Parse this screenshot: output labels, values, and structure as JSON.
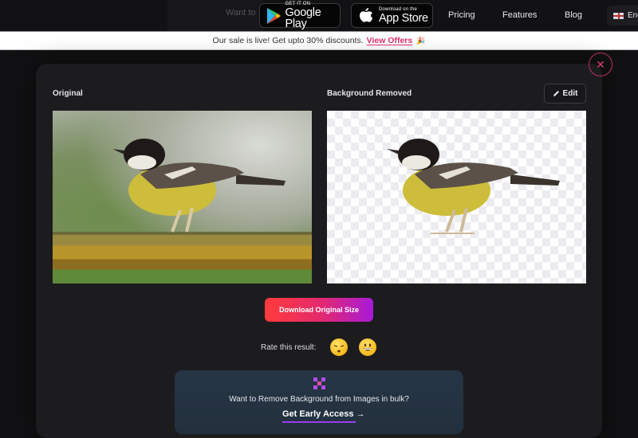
{
  "topnav": {
    "ghost_text": "Want to",
    "google_play": {
      "small": "GET IT ON",
      "big": "Google Play",
      "icon": "google-play-icon"
    },
    "app_store": {
      "small": "Download on the",
      "big": "App Store",
      "icon": "apple-icon"
    },
    "links": [
      {
        "label": "Pricing"
      },
      {
        "label": "Features"
      },
      {
        "label": "Blog"
      }
    ],
    "language": {
      "label": "Eng",
      "icon": "uk-flag-icon"
    }
  },
  "banner": {
    "text": "Our sale is live! Get upto 30% discounts.",
    "link": "View Offers",
    "emoji": "🎉"
  },
  "result": {
    "close_icon": "close-icon",
    "original_label": "Original",
    "removed_label": "Background Removed",
    "edit_label": "Edit",
    "edit_icon": "pencil-icon",
    "download_label": "Download Original Size",
    "rate_label": "Rate this result:",
    "rating_options": [
      "unamused-face",
      "grinning-face"
    ]
  },
  "bulk": {
    "icon": "bulk-grid-icon",
    "text": "Want to Remove Background from Images in bulk?",
    "cta": "Get Early Access",
    "cta_arrow": "→",
    "accent": "#9b3cf0"
  },
  "colors": {
    "page_bg": "#111113",
    "panel_bg": "#1c1c1f",
    "close_accent": "#b8315a",
    "download_gradient": [
      "#ff3b3b",
      "#e52a6b",
      "#a81ad8"
    ],
    "offer_link": "#e0306a"
  }
}
